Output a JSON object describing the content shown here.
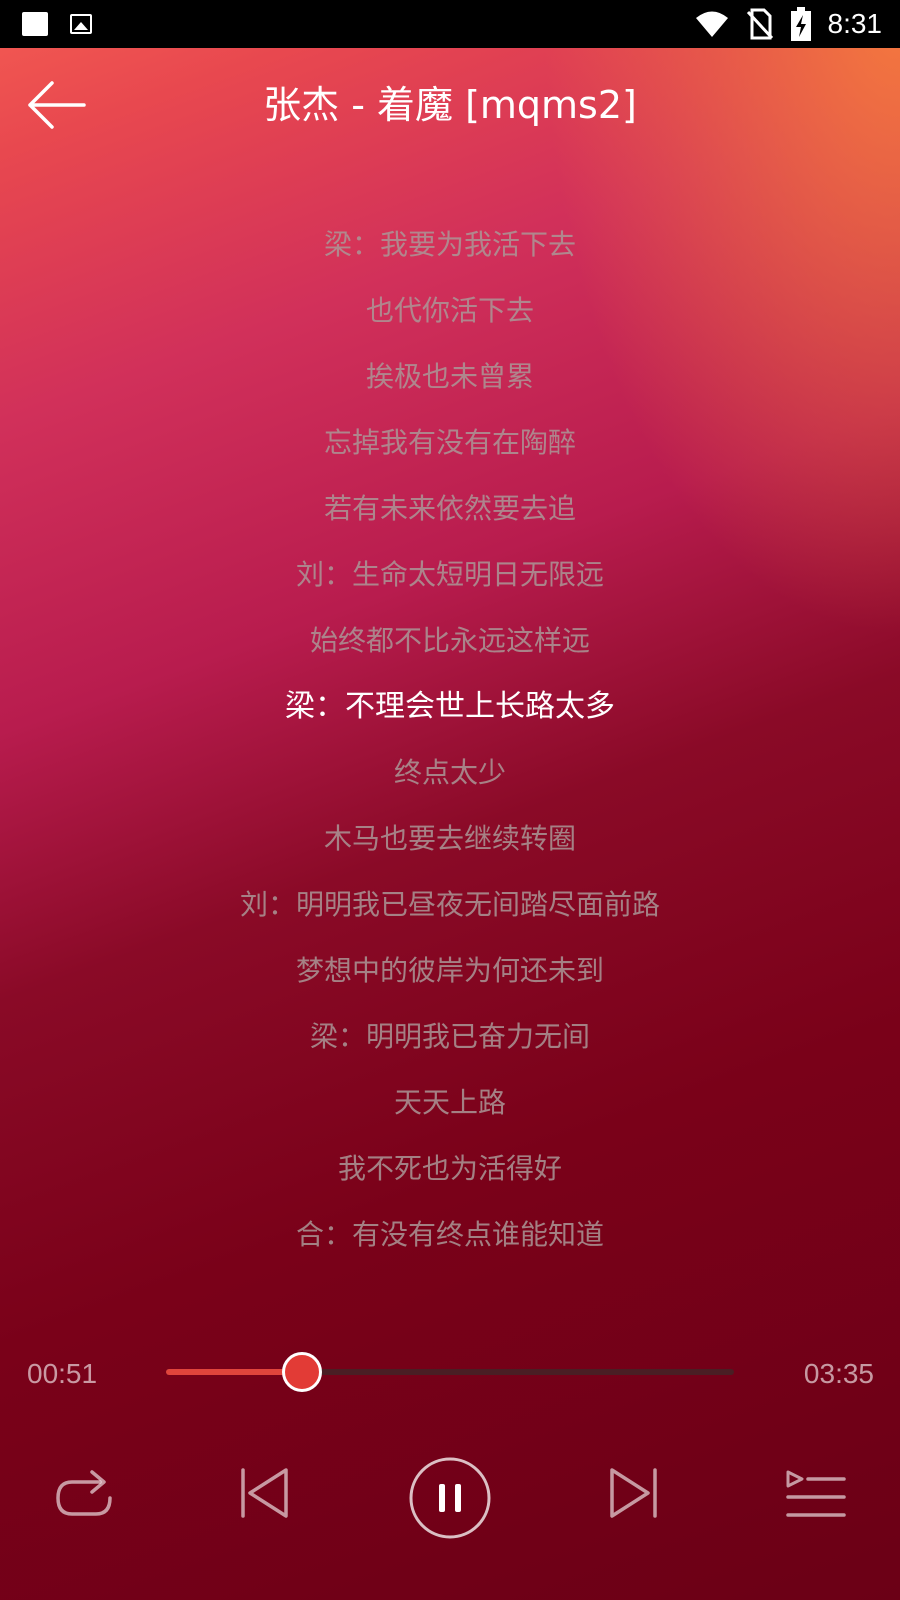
{
  "status_bar": {
    "time": "8:31"
  },
  "header": {
    "title": "张杰 - 着魔 [mqms2]"
  },
  "lyrics": {
    "lines": [
      "梁：我要为我活下去",
      "也代你活下去",
      "挨极也未曾累",
      "忘掉我有没有在陶醉",
      "若有未来依然要去追",
      "刘：生命太短明日无限远",
      "始终都不比永远这样远",
      "梁：不理会世上长路太多",
      "终点太少",
      "木马也要去继续转圈",
      "刘：明明我已昼夜无间踏尽面前路",
      "梦想中的彼岸为何还未到",
      "梁：明明我已奋力无间",
      "天天上路",
      "我不死也为活得好",
      "合：有没有终点谁能知道"
    ],
    "active_index": 7
  },
  "player": {
    "elapsed": "00:51",
    "duration": "03:35",
    "progress": 0.24
  },
  "controls": {
    "repeat_icon": "repeat-icon",
    "previous_icon": "skip-previous-icon",
    "play_pause_icon": "pause-icon",
    "next_icon": "skip-next-icon",
    "playlist_icon": "playlist-icon"
  },
  "colors": {
    "accent": "#e23b36",
    "active_lyric": "#ffffff",
    "inactive_lyric": "#aa9696"
  }
}
